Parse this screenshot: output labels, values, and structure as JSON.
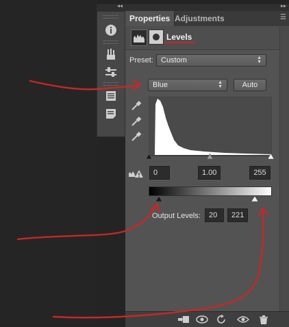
{
  "window": {
    "collapse_glyph": "◂◂",
    "expand_glyph": "▸▸",
    "menu_glyph": "☰"
  },
  "tabs": [
    {
      "label": "Properties",
      "active": true
    },
    {
      "label": "Adjustments",
      "active": false
    }
  ],
  "levels": {
    "title": "Levels",
    "preset_label": "Preset:",
    "preset_value": "Custom",
    "channel_value": "Blue",
    "auto_label": "Auto",
    "input_black": "0",
    "input_gamma": "1.00",
    "input_white": "255",
    "output_label": "Output Levels:",
    "output_black": "20",
    "output_white": "221"
  },
  "dock_icons": [
    "info-icon",
    "brushes-icon",
    "adjust-sliders-icon",
    "paragraph-icon",
    "notes-icon"
  ],
  "bottom_icons": [
    "clip-layer-icon",
    "view-previous-icon",
    "reset-icon",
    "visibility-eye-icon",
    "delete-trash-icon"
  ],
  "colors": {
    "annotation_arrow": "#c62828",
    "panel_bg": "#535353",
    "canvas_bg": "#252525"
  }
}
